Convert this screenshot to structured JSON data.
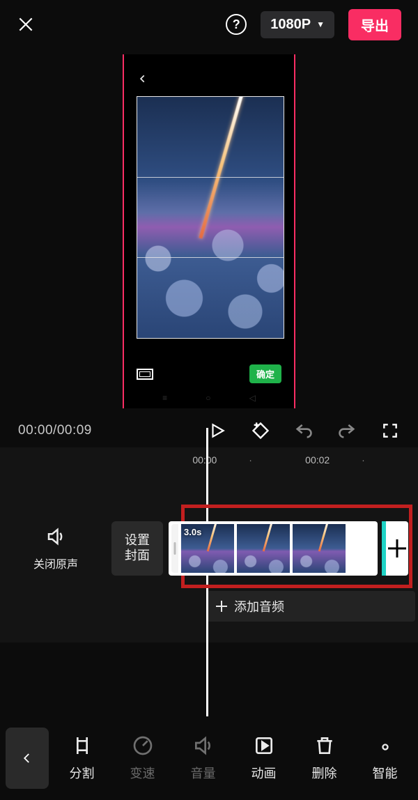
{
  "topbar": {
    "resolution": "1080P",
    "export": "导出"
  },
  "preview": {
    "confirm": "确定"
  },
  "transport": {
    "current": "00:00",
    "total": "00:09"
  },
  "ruler": {
    "tick0": "00:00",
    "tick1": "00:02"
  },
  "timeline": {
    "mute_label": "关闭原声",
    "cover_l1": "设置",
    "cover_l2": "封面",
    "clip_duration": "3.0s",
    "add_audio": "添加音频"
  },
  "tools": {
    "split": "分割",
    "speed": "变速",
    "volume": "音量",
    "anim": "动画",
    "delete": "删除",
    "smart": "智能"
  }
}
